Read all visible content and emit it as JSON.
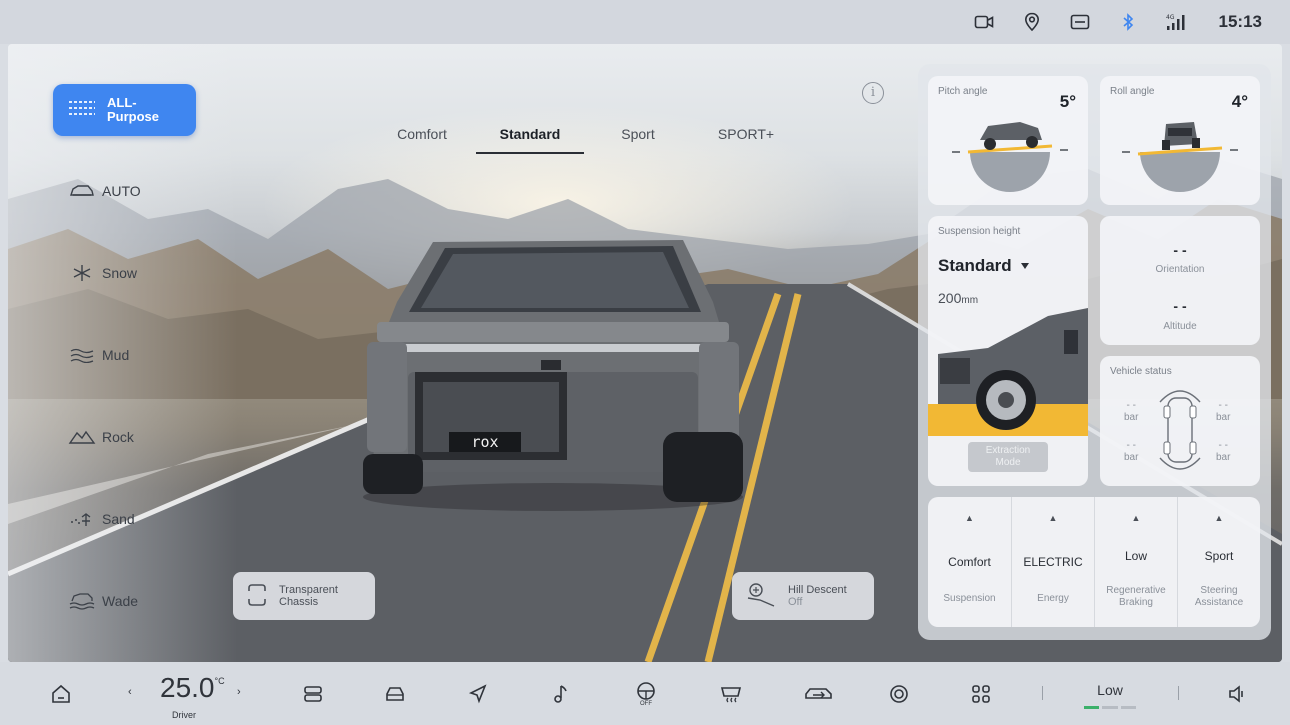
{
  "status_bar": {
    "time": "15:13",
    "icons": [
      "dashcam-icon",
      "location-icon",
      "message-icon",
      "bluetooth-icon",
      "signal-4g-icon"
    ],
    "signal_label": "4G"
  },
  "modes": {
    "active": {
      "label": "ALL-\nPurpose",
      "icon": "all-purpose-icon"
    },
    "items": [
      {
        "label": "AUTO",
        "icon": "auto-car-icon"
      },
      {
        "label": "Snow",
        "icon": "snowflake-icon"
      },
      {
        "label": "Mud",
        "icon": "mud-icon"
      },
      {
        "label": "Rock",
        "icon": "rock-icon"
      },
      {
        "label": "Sand",
        "icon": "sand-icon"
      },
      {
        "label": "Wade",
        "icon": "wade-icon"
      }
    ]
  },
  "drive_tabs": {
    "items": [
      "Comfort",
      "Standard",
      "Sport",
      "SPORT+"
    ],
    "selected": "Standard"
  },
  "info_icon": "i",
  "buttons": {
    "transparent_chassis": {
      "label": "Transparent\nChassis",
      "icon": "chassis-icon"
    },
    "hill_descent": {
      "label": "Hill Descent",
      "status": "Off",
      "icon": "hill-descent-icon"
    }
  },
  "vehicle_badge": "rox",
  "panel": {
    "pitch": {
      "title": "Pitch angle",
      "value": "5°"
    },
    "roll": {
      "title": "Roll angle",
      "value": "4°"
    },
    "suspension": {
      "title": "Suspension height",
      "mode": "Standard",
      "height_value": "200",
      "height_unit": "mm",
      "extraction": "Extraction\nMode"
    },
    "orientation": {
      "value": "- -",
      "label": "Orientation"
    },
    "altitude": {
      "value": "- -",
      "label": "Altitude"
    },
    "vehicle_status": {
      "title": "Vehicle status",
      "tires": [
        {
          "value": "- -",
          "unit": "bar"
        },
        {
          "value": "- -",
          "unit": "bar"
        },
        {
          "value": "- -",
          "unit": "bar"
        },
        {
          "value": "- -",
          "unit": "bar"
        }
      ]
    },
    "settings": [
      {
        "value": "Comfort",
        "label": "Suspension"
      },
      {
        "value": "ELECTRIC",
        "label": "Energy"
      },
      {
        "value": "Low",
        "label": "Regenerative\nBraking"
      },
      {
        "value": "Sport",
        "label": "Steering\nAssistance"
      }
    ]
  },
  "dock": {
    "temperature": "25.0",
    "temperature_unit": "°C",
    "seat": "Driver",
    "items": [
      "home-icon",
      "seat-icon",
      "car-icon",
      "navigation-icon",
      "music-icon",
      "steering-wheel-heat-icon",
      "rear-defrost-icon",
      "recirculation-icon",
      "camera-icon",
      "apps-icon"
    ],
    "steering_heat_label": "OFF",
    "fan_level": "Low",
    "volume_icon": "volume-icon",
    "accent": "#3f86f0",
    "level_indicator": "#3bb06a"
  }
}
